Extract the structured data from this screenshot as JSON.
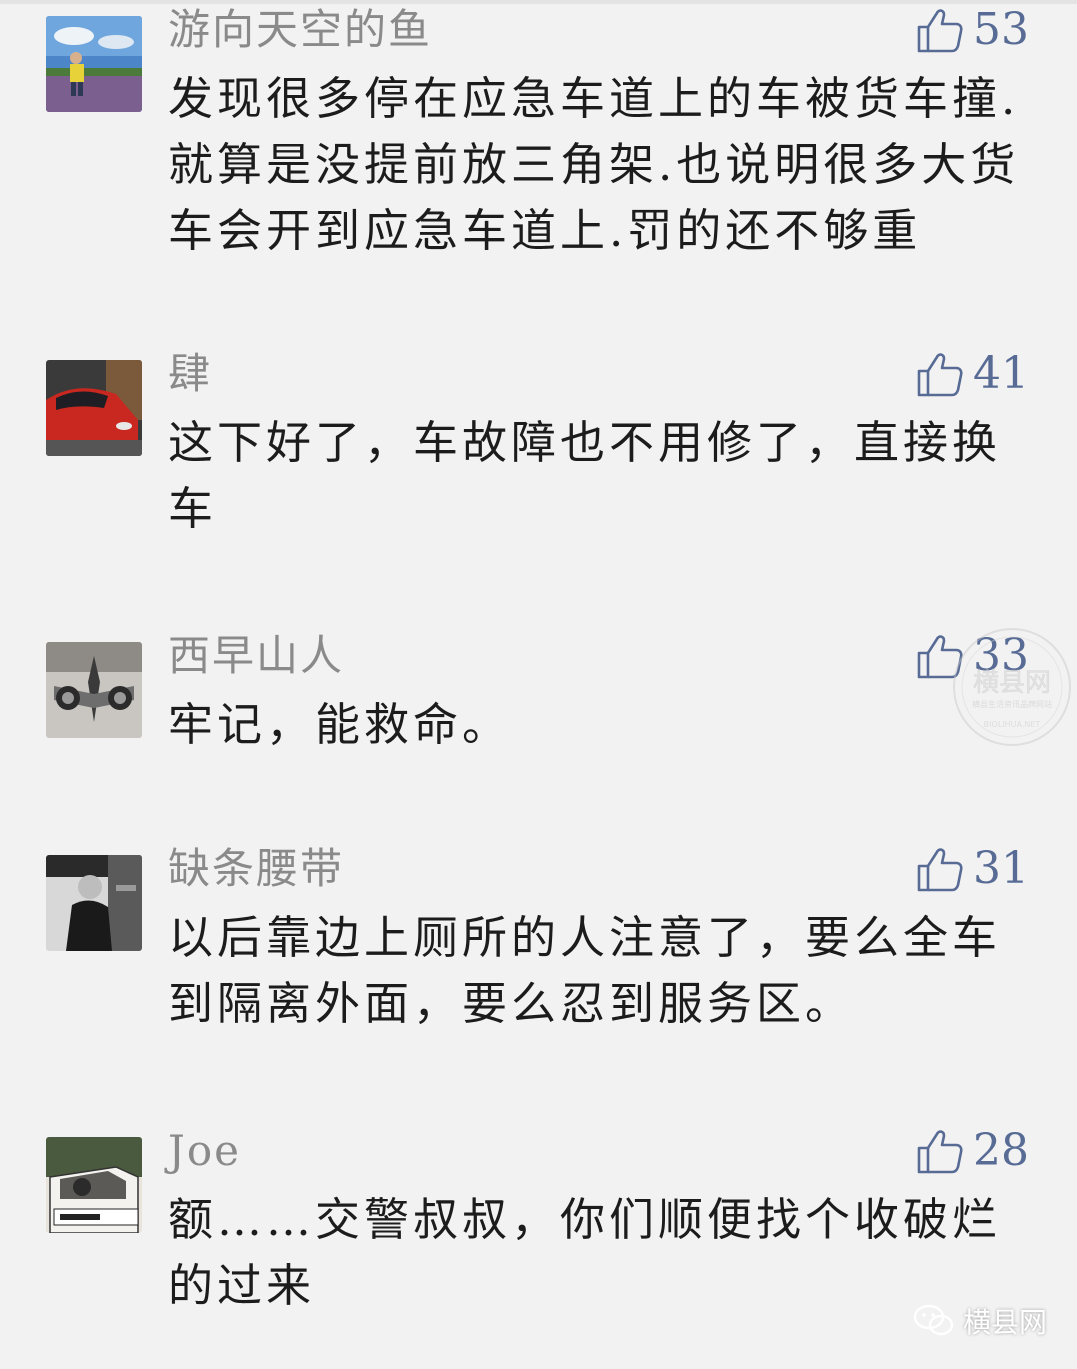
{
  "comments": [
    {
      "nickname": "游向天空的鱼",
      "likes": "53",
      "text": "发现很多停在应急车道上的车被货车撞.就算是没提前放三角架.也说明很多大货车会开到应急车道上.罚的还不够重",
      "avatar_icon": "person-in-field-photo"
    },
    {
      "nickname": "肆",
      "likes": "41",
      "text": "这下好了，车故障也不用修了，直接换车",
      "avatar_icon": "red-car-photo"
    },
    {
      "nickname": "西早山人",
      "likes": "33",
      "text": "牢记，能救命。",
      "avatar_icon": "jet-engine-photo"
    },
    {
      "nickname": "缺条腰带",
      "likes": "31",
      "text": "以后靠边上厕所的人注意了，要么全车到隔离外面，要么忍到服务区。",
      "avatar_icon": "bw-person-photo"
    },
    {
      "nickname": "Joe",
      "likes": "28",
      "text": "额……交警叔叔，你们顺便找个收破烂的过来",
      "avatar_icon": "anime-car-photo"
    }
  ],
  "watermark": {
    "title": "横县网",
    "subtitle": "横县生活资讯品牌网站",
    "url": "BIOLIHUA.NET"
  },
  "brand": {
    "name": "横县网",
    "icon": "wechat-icon"
  },
  "colors": {
    "background": "#f2f2f2",
    "nickname": "#8a8a8a",
    "like": "#576b95",
    "text": "#1c1c1c"
  }
}
